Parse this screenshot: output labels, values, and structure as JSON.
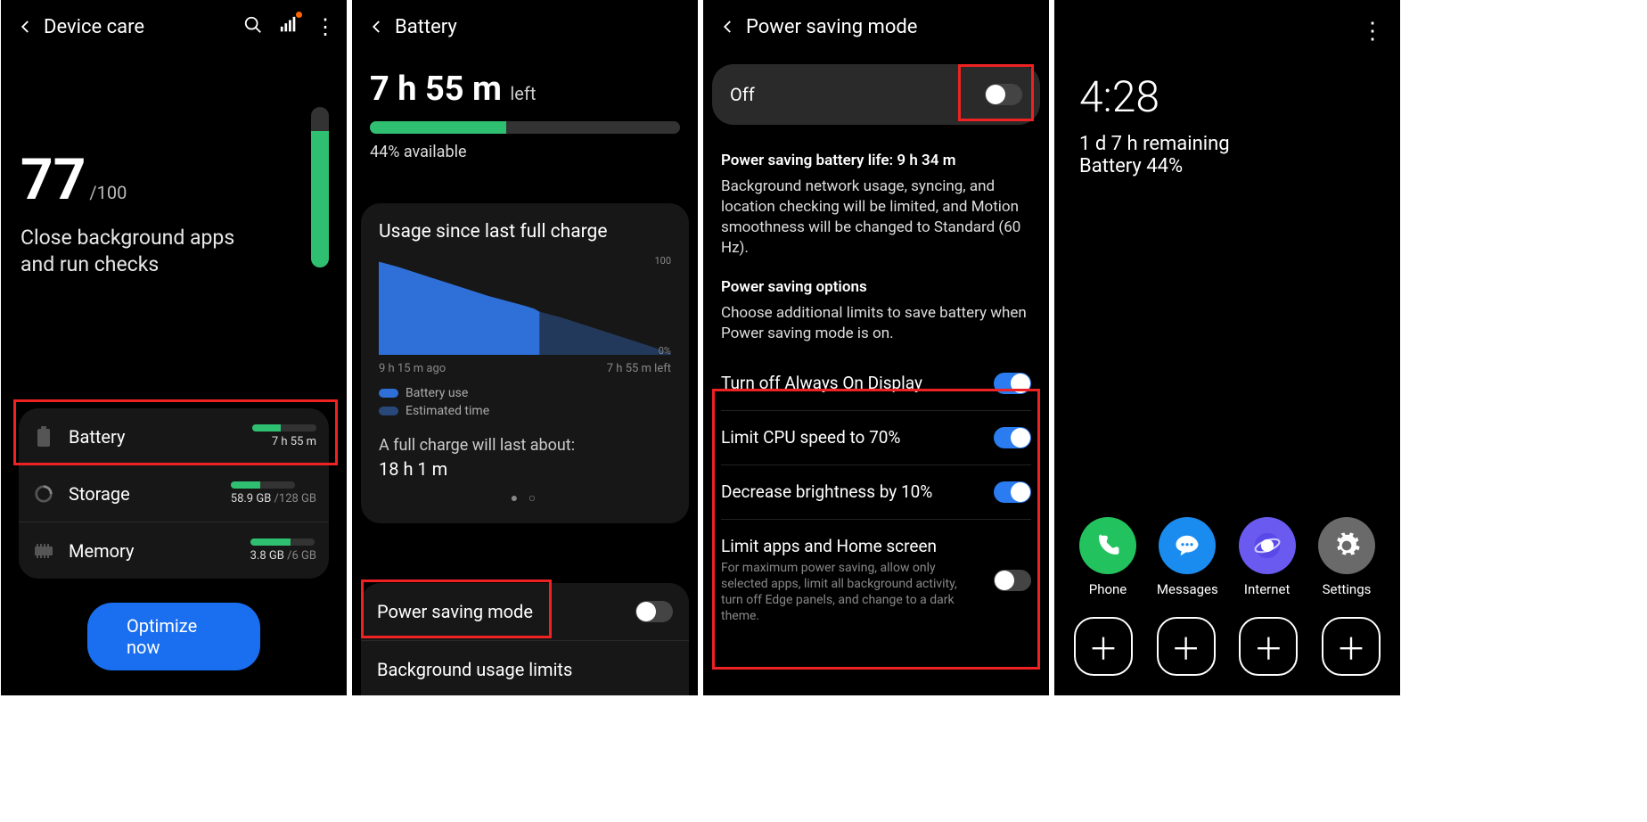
{
  "s1": {
    "title": "Device care",
    "score": "77",
    "score_of": "/100",
    "hint": "Close background apps and run checks",
    "items": [
      {
        "label": "Battery",
        "sub": "7 h 55 m",
        "pct": 44
      },
      {
        "label": "Storage",
        "sub": "58.9 GB",
        "sub2": "/128 GB",
        "pct": 46
      },
      {
        "label": "Memory",
        "sub": "3.8 GB",
        "sub2": "/6 GB",
        "pct": 63
      }
    ],
    "button": "Optimize now"
  },
  "s2": {
    "title": "Battery",
    "time": "7 h 55 m",
    "time_suffix": "left",
    "available": "44% available",
    "card_title": "Usage since last full charge",
    "range_start": "9 h 15 m ago",
    "range_end": "7 h 55 m left",
    "legend1": "Battery use",
    "legend2": "Estimated time",
    "estimate_label": "A full charge will last about:",
    "estimate_value": "18 h 1 m",
    "bottom": [
      "Power saving mode",
      "Background usage limits"
    ]
  },
  "s3": {
    "title": "Power saving mode",
    "master_label": "Off",
    "life_label": "Power saving battery life: 9 h 34 m",
    "life_desc": "Background network usage, syncing, and location checking will be limited, and Motion smoothness will be changed to Standard (60 Hz).",
    "opt_title": "Power saving options",
    "opt_desc": "Choose additional limits to save battery when Power saving mode is on.",
    "options": [
      {
        "label": "Turn off Always On Display",
        "on": true
      },
      {
        "label": "Limit CPU speed to 70%",
        "on": true
      },
      {
        "label": "Decrease brightness by 10%",
        "on": true
      },
      {
        "label": "Limit apps and Home screen",
        "sub": "For maximum power saving, allow only selected apps, limit all background activity, turn off Edge panels, and change to a dark theme.",
        "on": false
      }
    ]
  },
  "s4": {
    "clock": "4:28",
    "remaining": "1 d 7 h remaining",
    "battery": "Battery 44%",
    "apps": [
      "Phone",
      "Messages",
      "Internet",
      "Settings"
    ]
  },
  "chart_data": {
    "type": "area",
    "title": "Usage since last full charge",
    "xlabel": "",
    "ylabel": "%",
    "ylim": [
      0,
      100
    ],
    "x_range_labels": [
      "9 h 15 m ago",
      "7 h 55 m left"
    ],
    "series": [
      {
        "name": "Battery use",
        "color": "#2e6fd8",
        "values": [
          100,
          95,
          90,
          84,
          78,
          72,
          66,
          60,
          55,
          50,
          47,
          44
        ]
      },
      {
        "name": "Estimated time",
        "color": "#29487a",
        "values": [
          44,
          41,
          38,
          35,
          32,
          29,
          26,
          23,
          20,
          17,
          14,
          11,
          8,
          5,
          2,
          0
        ]
      }
    ],
    "legend": [
      "Battery use",
      "Estimated time"
    ]
  }
}
